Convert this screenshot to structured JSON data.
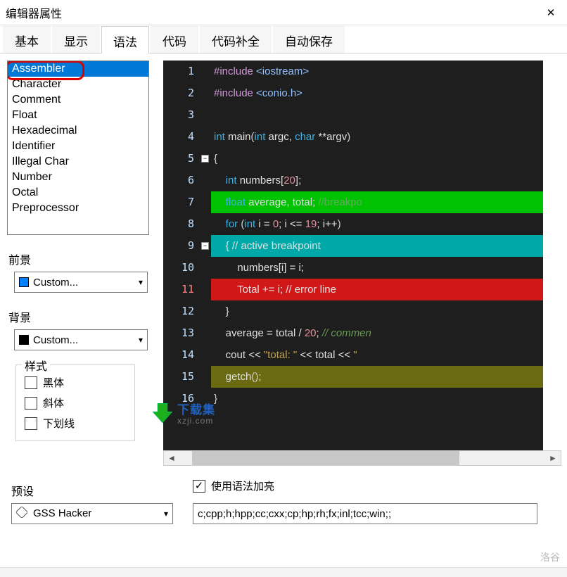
{
  "window": {
    "title": "编辑器属性"
  },
  "tabs": [
    {
      "label": "基本"
    },
    {
      "label": "显示"
    },
    {
      "label": "语法",
      "active": true
    },
    {
      "label": "代码"
    },
    {
      "label": "代码补全"
    },
    {
      "label": "自动保存"
    }
  ],
  "syntax_list": [
    {
      "label": "Assembler",
      "selected": true
    },
    {
      "label": "Character"
    },
    {
      "label": "Comment"
    },
    {
      "label": "Float"
    },
    {
      "label": "Hexadecimal"
    },
    {
      "label": "Identifier"
    },
    {
      "label": "Illegal Char"
    },
    {
      "label": "Number"
    },
    {
      "label": "Octal"
    },
    {
      "label": "Preprocessor"
    }
  ],
  "foreground": {
    "label": "前景",
    "value": "Custom...",
    "swatch": "#0080ff"
  },
  "background": {
    "label": "背景",
    "value": "Custom...",
    "swatch": "#000000"
  },
  "styles": {
    "title": "样式",
    "bold": {
      "label": "黑体",
      "checked": false
    },
    "italic": {
      "label": "斜体",
      "checked": false
    },
    "underline": {
      "label": "下划线",
      "checked": false
    }
  },
  "preset": {
    "label": "预设",
    "value": "GSS Hacker"
  },
  "syntax_highlight": {
    "label": "使用语法加亮",
    "checked": true
  },
  "extensions": {
    "value": "c;cpp;h;hpp;cc;cxx;cp;hp;rh;fx;inl;tcc;win;;"
  },
  "editor_code": {
    "lines": [
      {
        "n": 1,
        "segs": [
          {
            "t": "#include ",
            "c": "kw-pp"
          },
          {
            "t": "<iostream>",
            "c": "kw-inc"
          }
        ]
      },
      {
        "n": 2,
        "segs": [
          {
            "t": "#include ",
            "c": "kw-pp"
          },
          {
            "t": "<conio.h>",
            "c": "kw-inc"
          }
        ]
      },
      {
        "n": 3,
        "segs": []
      },
      {
        "n": 4,
        "segs": [
          {
            "t": "int ",
            "c": "kw-type"
          },
          {
            "t": "main",
            "c": ""
          },
          {
            "t": "(",
            "c": "kw-op"
          },
          {
            "t": "int ",
            "c": "kw-type"
          },
          {
            "t": "argc, ",
            "c": ""
          },
          {
            "t": "char ",
            "c": "kw-type"
          },
          {
            "t": "**argv",
            "c": ""
          },
          {
            "t": ")",
            "c": "kw-op"
          }
        ]
      },
      {
        "n": 5,
        "fold": true,
        "segs": [
          {
            "t": "{",
            "c": "kw-op"
          }
        ]
      },
      {
        "n": 6,
        "segs": [
          {
            "t": "    ",
            "c": ""
          },
          {
            "t": "int ",
            "c": "kw-type"
          },
          {
            "t": "numbers[",
            "c": ""
          },
          {
            "t": "20",
            "c": "kw-num"
          },
          {
            "t": "];",
            "c": ""
          }
        ]
      },
      {
        "n": 7,
        "bg": "bg-green",
        "segs": [
          {
            "t": "    ",
            "c": ""
          },
          {
            "t": "float ",
            "c": "kw-type"
          },
          {
            "t": "average, total; ",
            "c": ""
          },
          {
            "t": "//breakpo",
            "c": "kw-cmt"
          }
        ]
      },
      {
        "n": 8,
        "segs": [
          {
            "t": "    ",
            "c": ""
          },
          {
            "t": "for ",
            "c": "kw-kw"
          },
          {
            "t": "(",
            "c": "kw-op"
          },
          {
            "t": "int ",
            "c": "kw-type"
          },
          {
            "t": "i = ",
            "c": ""
          },
          {
            "t": "0",
            "c": "kw-num"
          },
          {
            "t": "; i <= ",
            "c": ""
          },
          {
            "t": "19",
            "c": "kw-num"
          },
          {
            "t": "; i++",
            "c": ""
          },
          {
            "t": ")",
            "c": "kw-op"
          }
        ]
      },
      {
        "n": 9,
        "fold": true,
        "bg": "bg-teal",
        "segs": [
          {
            "t": "    { ",
            "c": ""
          },
          {
            "t": "// active breakpoint",
            "c": ""
          }
        ]
      },
      {
        "n": 10,
        "segs": [
          {
            "t": "        numbers[i] = i;",
            "c": ""
          }
        ]
      },
      {
        "n": 11,
        "bg": "bg-red",
        "lnc": "ln-red",
        "segs": [
          {
            "t": "        Total += i; ",
            "c": ""
          },
          {
            "t": "// error line",
            "c": ""
          }
        ]
      },
      {
        "n": 12,
        "segs": [
          {
            "t": "    }",
            "c": ""
          }
        ]
      },
      {
        "n": 13,
        "segs": [
          {
            "t": "    average = total / ",
            "c": ""
          },
          {
            "t": "20",
            "c": "kw-num"
          },
          {
            "t": "; ",
            "c": ""
          },
          {
            "t": "// commen",
            "c": "kw-cmt2"
          }
        ]
      },
      {
        "n": 14,
        "segs": [
          {
            "t": "    cout << ",
            "c": ""
          },
          {
            "t": "\"total: \"",
            "c": "kw-str"
          },
          {
            "t": " << total << ",
            "c": ""
          },
          {
            "t": "\"",
            "c": "kw-str"
          }
        ]
      },
      {
        "n": 15,
        "bg": "bg-olive",
        "segs": [
          {
            "t": "    getch",
            "c": ""
          },
          {
            "t": "()",
            "c": "kw-op"
          },
          {
            "t": ";",
            "c": ""
          }
        ]
      },
      {
        "n": 16,
        "segs": [
          {
            "t": "}",
            "c": "kw-op"
          }
        ]
      }
    ]
  },
  "logo": {
    "line1": "下载集",
    "line2": "xzji.com"
  },
  "watermark": "洛谷"
}
